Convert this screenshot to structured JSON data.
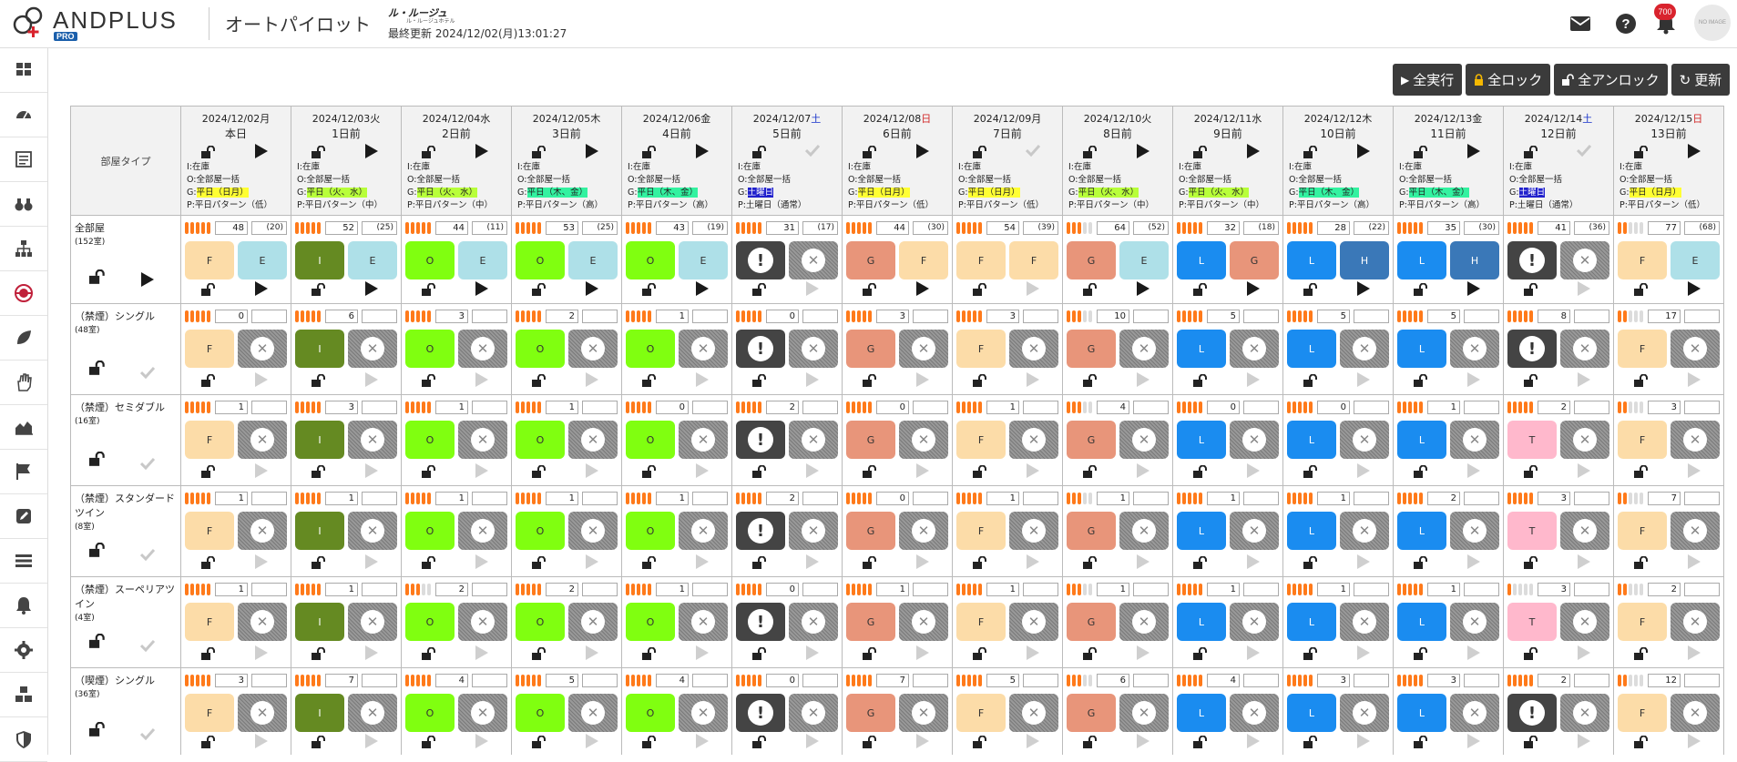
{
  "header": {
    "logo_text": "ANDPLUS",
    "logo_badge": "PRO",
    "app_title": "オートパイロット",
    "brand_logo": "ル・ルージュ",
    "brand_sub": "ル・ルージュホテル",
    "last_updated": "最終更新 2024/12/02(月)13:01:27",
    "notification_count": "700",
    "avatar_text": "NO IMAGE"
  },
  "sidebar": {
    "items": [
      "dashboard-icon",
      "speedometer-icon",
      "calendar-list-icon",
      "binoculars-icon",
      "sitemap-icon",
      "autopilot-icon",
      "leaf-icon",
      "hand-icon",
      "area-chart-icon",
      "flag-icon",
      "edit-icon",
      "list-icon",
      "bell-icon",
      "gear-icon",
      "cubes-icon",
      "shield-icon"
    ]
  },
  "actions": {
    "run_all": "全実行",
    "lock_all": "全ロック",
    "unlock_all": "全アンロック",
    "refresh": "更新"
  },
  "table": {
    "roomtype_header": "部屋タイプ",
    "dates": [
      {
        "date": "2024/12/02",
        "dow": "月",
        "dow_type": "weekday",
        "ago": "本日",
        "active": true,
        "I": "I:在庫",
        "O": "O:全部屋一括",
        "G_label": "平日（日月）",
        "g_color": "yel",
        "P": "P:平日パターン（低）"
      },
      {
        "date": "2024/12/03",
        "dow": "火",
        "dow_type": "weekday",
        "ago": "1日前",
        "active": true,
        "I": "I:在庫",
        "O": "O:全部屋一括",
        "G_label": "平日（火、水）",
        "g_color": "lime",
        "P": "P:平日パターン（中）"
      },
      {
        "date": "2024/12/04",
        "dow": "水",
        "dow_type": "weekday",
        "ago": "2日前",
        "active": true,
        "I": "I:在庫",
        "O": "O:全部屋一括",
        "G_label": "平日（火、水）",
        "g_color": "lime",
        "P": "P:平日パターン（中）"
      },
      {
        "date": "2024/12/05",
        "dow": "木",
        "dow_type": "weekday",
        "ago": "3日前",
        "active": true,
        "I": "I:在庫",
        "O": "O:全部屋一括",
        "G_label": "平日（木、金）",
        "g_color": "teal",
        "P": "P:平日パターン（高）"
      },
      {
        "date": "2024/12/06",
        "dow": "金",
        "dow_type": "weekday",
        "ago": "4日前",
        "active": true,
        "I": "I:在庫",
        "O": "O:全部屋一括",
        "G_label": "平日（木、金）",
        "g_color": "teal",
        "P": "P:平日パターン（高）"
      },
      {
        "date": "2024/12/07",
        "dow": "土",
        "dow_type": "sat",
        "ago": "5日前",
        "active": false,
        "I": "I:在庫",
        "O": "O:全部屋一括",
        "G_label": "土曜日",
        "g_color": "blue",
        "P": "P:土曜日（通常）"
      },
      {
        "date": "2024/12/08",
        "dow": "日",
        "dow_type": "sun",
        "ago": "6日前",
        "active": true,
        "I": "I:在庫",
        "O": "O:全部屋一括",
        "G_label": "平日（日月）",
        "g_color": "yel",
        "P": "P:平日パターン（低）"
      },
      {
        "date": "2024/12/09",
        "dow": "月",
        "dow_type": "weekday",
        "ago": "7日前",
        "active": false,
        "I": "I:在庫",
        "O": "O:全部屋一括",
        "G_label": "平日（日月）",
        "g_color": "yel",
        "P": "P:平日パターン（低）"
      },
      {
        "date": "2024/12/10",
        "dow": "火",
        "dow_type": "weekday",
        "ago": "8日前",
        "active": true,
        "I": "I:在庫",
        "O": "O:全部屋一括",
        "G_label": "平日（火、水）",
        "g_color": "lime",
        "P": "P:平日パターン（中）"
      },
      {
        "date": "2024/12/11",
        "dow": "水",
        "dow_type": "weekday",
        "ago": "9日前",
        "active": true,
        "I": "I:在庫",
        "O": "O:全部屋一括",
        "G_label": "平日（火、水）",
        "g_color": "lime",
        "P": "P:平日パターン（中）"
      },
      {
        "date": "2024/12/12",
        "dow": "木",
        "dow_type": "weekday",
        "ago": "10日前",
        "active": true,
        "I": "I:在庫",
        "O": "O:全部屋一括",
        "G_label": "平日（木、金）",
        "g_color": "teal",
        "P": "P:平日パターン（高）"
      },
      {
        "date": "2024/12/13",
        "dow": "金",
        "dow_type": "weekday",
        "ago": "11日前",
        "active": true,
        "I": "I:在庫",
        "O": "O:全部屋一括",
        "G_label": "平日（木、金）",
        "g_color": "teal",
        "P": "P:平日パターン（高）"
      },
      {
        "date": "2024/12/14",
        "dow": "土",
        "dow_type": "sat",
        "ago": "12日前",
        "active": false,
        "I": "I:在庫",
        "O": "O:全部屋一括",
        "G_label": "土曜日",
        "g_color": "blue",
        "P": "P:土曜日（通常）"
      },
      {
        "date": "2024/12/15",
        "dow": "日",
        "dow_type": "sun",
        "ago": "13日前",
        "active": true,
        "I": "I:在庫",
        "O": "O:全部屋一括",
        "G_label": "平日（日月）",
        "g_color": "yel",
        "P": "P:平日パターン（低）"
      }
    ],
    "rows": [
      {
        "name": "全部屋",
        "count": "(152室)",
        "active": true,
        "cells": [
          {
            "bars": 5,
            "value": "48",
            "sub": "(20)",
            "L": "F",
            "R": "E",
            "run": true
          },
          {
            "bars": 5,
            "value": "52",
            "sub": "(25)",
            "L": "I",
            "R": "E",
            "run": true
          },
          {
            "bars": 5,
            "value": "44",
            "sub": "(11)",
            "L": "O",
            "R": "E",
            "run": true
          },
          {
            "bars": 5,
            "value": "53",
            "sub": "(25)",
            "L": "O",
            "R": "E",
            "run": true
          },
          {
            "bars": 5,
            "value": "43",
            "sub": "(19)",
            "L": "O",
            "R": "E",
            "run": true
          },
          {
            "bars": 5,
            "value": "31",
            "sub": "(17)",
            "L": "X",
            "R": "off",
            "run": false
          },
          {
            "bars": 5,
            "value": "44",
            "sub": "(30)",
            "L": "G",
            "R": "F",
            "run": true
          },
          {
            "bars": 5,
            "value": "54",
            "sub": "(39)",
            "L": "F",
            "R": "F",
            "run": false
          },
          {
            "bars": 3,
            "value": "64",
            "sub": "(52)",
            "L": "G",
            "R": "E",
            "run": true
          },
          {
            "bars": 5,
            "value": "32",
            "sub": "(18)",
            "L": "L",
            "R": "G",
            "run": true
          },
          {
            "bars": 5,
            "value": "28",
            "sub": "(22)",
            "L": "L",
            "R": "H",
            "run": true
          },
          {
            "bars": 5,
            "value": "35",
            "sub": "(30)",
            "L": "L",
            "R": "H",
            "run": true
          },
          {
            "bars": 5,
            "value": "41",
            "sub": "(36)",
            "L": "X",
            "R": "off",
            "run": false
          },
          {
            "bars": 2,
            "value": "77",
            "sub": "(68)",
            "L": "F",
            "R": "E",
            "run": true
          }
        ]
      },
      {
        "name": "（禁煙）シングル",
        "count": "(48室)",
        "active": false,
        "cells": [
          {
            "bars": 5,
            "value": "0",
            "sub": "",
            "L": "F",
            "R": "off",
            "run": false
          },
          {
            "bars": 5,
            "value": "6",
            "sub": "",
            "L": "I",
            "R": "off",
            "run": false
          },
          {
            "bars": 5,
            "value": "3",
            "sub": "",
            "L": "O",
            "R": "off",
            "run": false
          },
          {
            "bars": 5,
            "value": "2",
            "sub": "",
            "L": "O",
            "R": "off",
            "run": false
          },
          {
            "bars": 5,
            "value": "1",
            "sub": "",
            "L": "O",
            "R": "off",
            "run": false
          },
          {
            "bars": 5,
            "value": "0",
            "sub": "",
            "L": "X",
            "R": "off",
            "run": false
          },
          {
            "bars": 5,
            "value": "3",
            "sub": "",
            "L": "G",
            "R": "off",
            "run": false
          },
          {
            "bars": 5,
            "value": "3",
            "sub": "",
            "L": "F",
            "R": "off",
            "run": false
          },
          {
            "bars": 3,
            "value": "10",
            "sub": "",
            "L": "G",
            "R": "off",
            "run": false
          },
          {
            "bars": 5,
            "value": "5",
            "sub": "",
            "L": "L",
            "R": "off",
            "run": false
          },
          {
            "bars": 5,
            "value": "5",
            "sub": "",
            "L": "L",
            "R": "off",
            "run": false
          },
          {
            "bars": 5,
            "value": "5",
            "sub": "",
            "L": "L",
            "R": "off",
            "run": false
          },
          {
            "bars": 5,
            "value": "8",
            "sub": "",
            "L": "X",
            "R": "off",
            "run": false
          },
          {
            "bars": 2,
            "value": "17",
            "sub": "",
            "L": "F",
            "R": "off",
            "run": false
          }
        ]
      },
      {
        "name": "（禁煙）セミダブル",
        "count": "(16室)",
        "active": false,
        "cells": [
          {
            "bars": 5,
            "value": "1",
            "sub": "",
            "L": "F",
            "R": "off",
            "run": false
          },
          {
            "bars": 5,
            "value": "3",
            "sub": "",
            "L": "I",
            "R": "off",
            "run": false
          },
          {
            "bars": 5,
            "value": "1",
            "sub": "",
            "L": "O",
            "R": "off",
            "run": false
          },
          {
            "bars": 5,
            "value": "1",
            "sub": "",
            "L": "O",
            "R": "off",
            "run": false
          },
          {
            "bars": 5,
            "value": "0",
            "sub": "",
            "L": "O",
            "R": "off",
            "run": false
          },
          {
            "bars": 5,
            "value": "2",
            "sub": "",
            "L": "X",
            "R": "off",
            "run": false
          },
          {
            "bars": 5,
            "value": "0",
            "sub": "",
            "L": "G",
            "R": "off",
            "run": false
          },
          {
            "bars": 5,
            "value": "1",
            "sub": "",
            "L": "F",
            "R": "off",
            "run": false
          },
          {
            "bars": 3,
            "value": "4",
            "sub": "",
            "L": "G",
            "R": "off",
            "run": false
          },
          {
            "bars": 5,
            "value": "0",
            "sub": "",
            "L": "L",
            "R": "off",
            "run": false
          },
          {
            "bars": 5,
            "value": "0",
            "sub": "",
            "L": "L",
            "R": "off",
            "run": false
          },
          {
            "bars": 5,
            "value": "1",
            "sub": "",
            "L": "L",
            "R": "off",
            "run": false
          },
          {
            "bars": 5,
            "value": "2",
            "sub": "",
            "L": "T",
            "R": "off",
            "run": false
          },
          {
            "bars": 2,
            "value": "3",
            "sub": "",
            "L": "F",
            "R": "off",
            "run": false
          }
        ]
      },
      {
        "name": "（禁煙）スタンダードツイン",
        "count": "(8室)",
        "active": false,
        "cells": [
          {
            "bars": 5,
            "value": "1",
            "sub": "",
            "L": "F",
            "R": "off",
            "run": false
          },
          {
            "bars": 5,
            "value": "1",
            "sub": "",
            "L": "I",
            "R": "off",
            "run": false
          },
          {
            "bars": 5,
            "value": "1",
            "sub": "",
            "L": "O",
            "R": "off",
            "run": false
          },
          {
            "bars": 5,
            "value": "1",
            "sub": "",
            "L": "O",
            "R": "off",
            "run": false
          },
          {
            "bars": 5,
            "value": "1",
            "sub": "",
            "L": "O",
            "R": "off",
            "run": false
          },
          {
            "bars": 5,
            "value": "2",
            "sub": "",
            "L": "X",
            "R": "off",
            "run": false
          },
          {
            "bars": 5,
            "value": "0",
            "sub": "",
            "L": "G",
            "R": "off",
            "run": false
          },
          {
            "bars": 5,
            "value": "1",
            "sub": "",
            "L": "F",
            "R": "off",
            "run": false
          },
          {
            "bars": 3,
            "value": "1",
            "sub": "",
            "L": "G",
            "R": "off",
            "run": false
          },
          {
            "bars": 5,
            "value": "1",
            "sub": "",
            "L": "L",
            "R": "off",
            "run": false
          },
          {
            "bars": 5,
            "value": "1",
            "sub": "",
            "L": "L",
            "R": "off",
            "run": false
          },
          {
            "bars": 5,
            "value": "2",
            "sub": "",
            "L": "L",
            "R": "off",
            "run": false
          },
          {
            "bars": 5,
            "value": "3",
            "sub": "",
            "L": "T",
            "R": "off",
            "run": false
          },
          {
            "bars": 2,
            "value": "7",
            "sub": "",
            "L": "F",
            "R": "off",
            "run": false
          }
        ]
      },
      {
        "name": "（禁煙）スーペリアツイン",
        "count": "(4室)",
        "active": false,
        "cells": [
          {
            "bars": 5,
            "value": "1",
            "sub": "",
            "L": "F",
            "R": "off",
            "run": false
          },
          {
            "bars": 5,
            "value": "1",
            "sub": "",
            "L": "I",
            "R": "off",
            "run": false
          },
          {
            "bars": 3,
            "value": "2",
            "sub": "",
            "L": "O",
            "R": "off",
            "run": false
          },
          {
            "bars": 5,
            "value": "2",
            "sub": "",
            "L": "O",
            "R": "off",
            "run": false
          },
          {
            "bars": 5,
            "value": "1",
            "sub": "",
            "L": "O",
            "R": "off",
            "run": false
          },
          {
            "bars": 5,
            "value": "0",
            "sub": "",
            "L": "X",
            "R": "off",
            "run": false
          },
          {
            "bars": 5,
            "value": "1",
            "sub": "",
            "L": "G",
            "R": "off",
            "run": false
          },
          {
            "bars": 5,
            "value": "1",
            "sub": "",
            "L": "F",
            "R": "off",
            "run": false
          },
          {
            "bars": 3,
            "value": "1",
            "sub": "",
            "L": "G",
            "R": "off",
            "run": false
          },
          {
            "bars": 5,
            "value": "1",
            "sub": "",
            "L": "L",
            "R": "off",
            "run": false
          },
          {
            "bars": 5,
            "value": "1",
            "sub": "",
            "L": "L",
            "R": "off",
            "run": false
          },
          {
            "bars": 5,
            "value": "1",
            "sub": "",
            "L": "L",
            "R": "off",
            "run": false
          },
          {
            "bars": 1,
            "value": "3",
            "sub": "",
            "L": "T",
            "R": "off",
            "run": false
          },
          {
            "bars": 2,
            "value": "2",
            "sub": "",
            "L": "F",
            "R": "off",
            "run": false
          }
        ]
      },
      {
        "name": "（喫煙）シングル",
        "count": "(36室)",
        "active": false,
        "cells": [
          {
            "bars": 5,
            "value": "3",
            "sub": "",
            "L": "F",
            "R": "off",
            "run": false
          },
          {
            "bars": 5,
            "value": "7",
            "sub": "",
            "L": "I",
            "R": "off",
            "run": false
          },
          {
            "bars": 5,
            "value": "4",
            "sub": "",
            "L": "O",
            "R": "off",
            "run": false
          },
          {
            "bars": 5,
            "value": "5",
            "sub": "",
            "L": "O",
            "R": "off",
            "run": false
          },
          {
            "bars": 5,
            "value": "4",
            "sub": "",
            "L": "O",
            "R": "off",
            "run": false
          },
          {
            "bars": 5,
            "value": "0",
            "sub": "",
            "L": "X",
            "R": "off",
            "run": false
          },
          {
            "bars": 5,
            "value": "7",
            "sub": "",
            "L": "G",
            "R": "off",
            "run": false
          },
          {
            "bars": 5,
            "value": "5",
            "sub": "",
            "L": "F",
            "R": "off",
            "run": false
          },
          {
            "bars": 3,
            "value": "6",
            "sub": "",
            "L": "G",
            "R": "off",
            "run": false
          },
          {
            "bars": 5,
            "value": "4",
            "sub": "",
            "L": "L",
            "R": "off",
            "run": false
          },
          {
            "bars": 5,
            "value": "3",
            "sub": "",
            "L": "L",
            "R": "off",
            "run": false
          },
          {
            "bars": 5,
            "value": "3",
            "sub": "",
            "L": "L",
            "R": "off",
            "run": false
          },
          {
            "bars": 5,
            "value": "2",
            "sub": "",
            "L": "X",
            "R": "off",
            "run": false
          },
          {
            "bars": 2,
            "value": "12",
            "sub": "",
            "L": "F",
            "R": "off",
            "run": false
          }
        ]
      }
    ]
  }
}
